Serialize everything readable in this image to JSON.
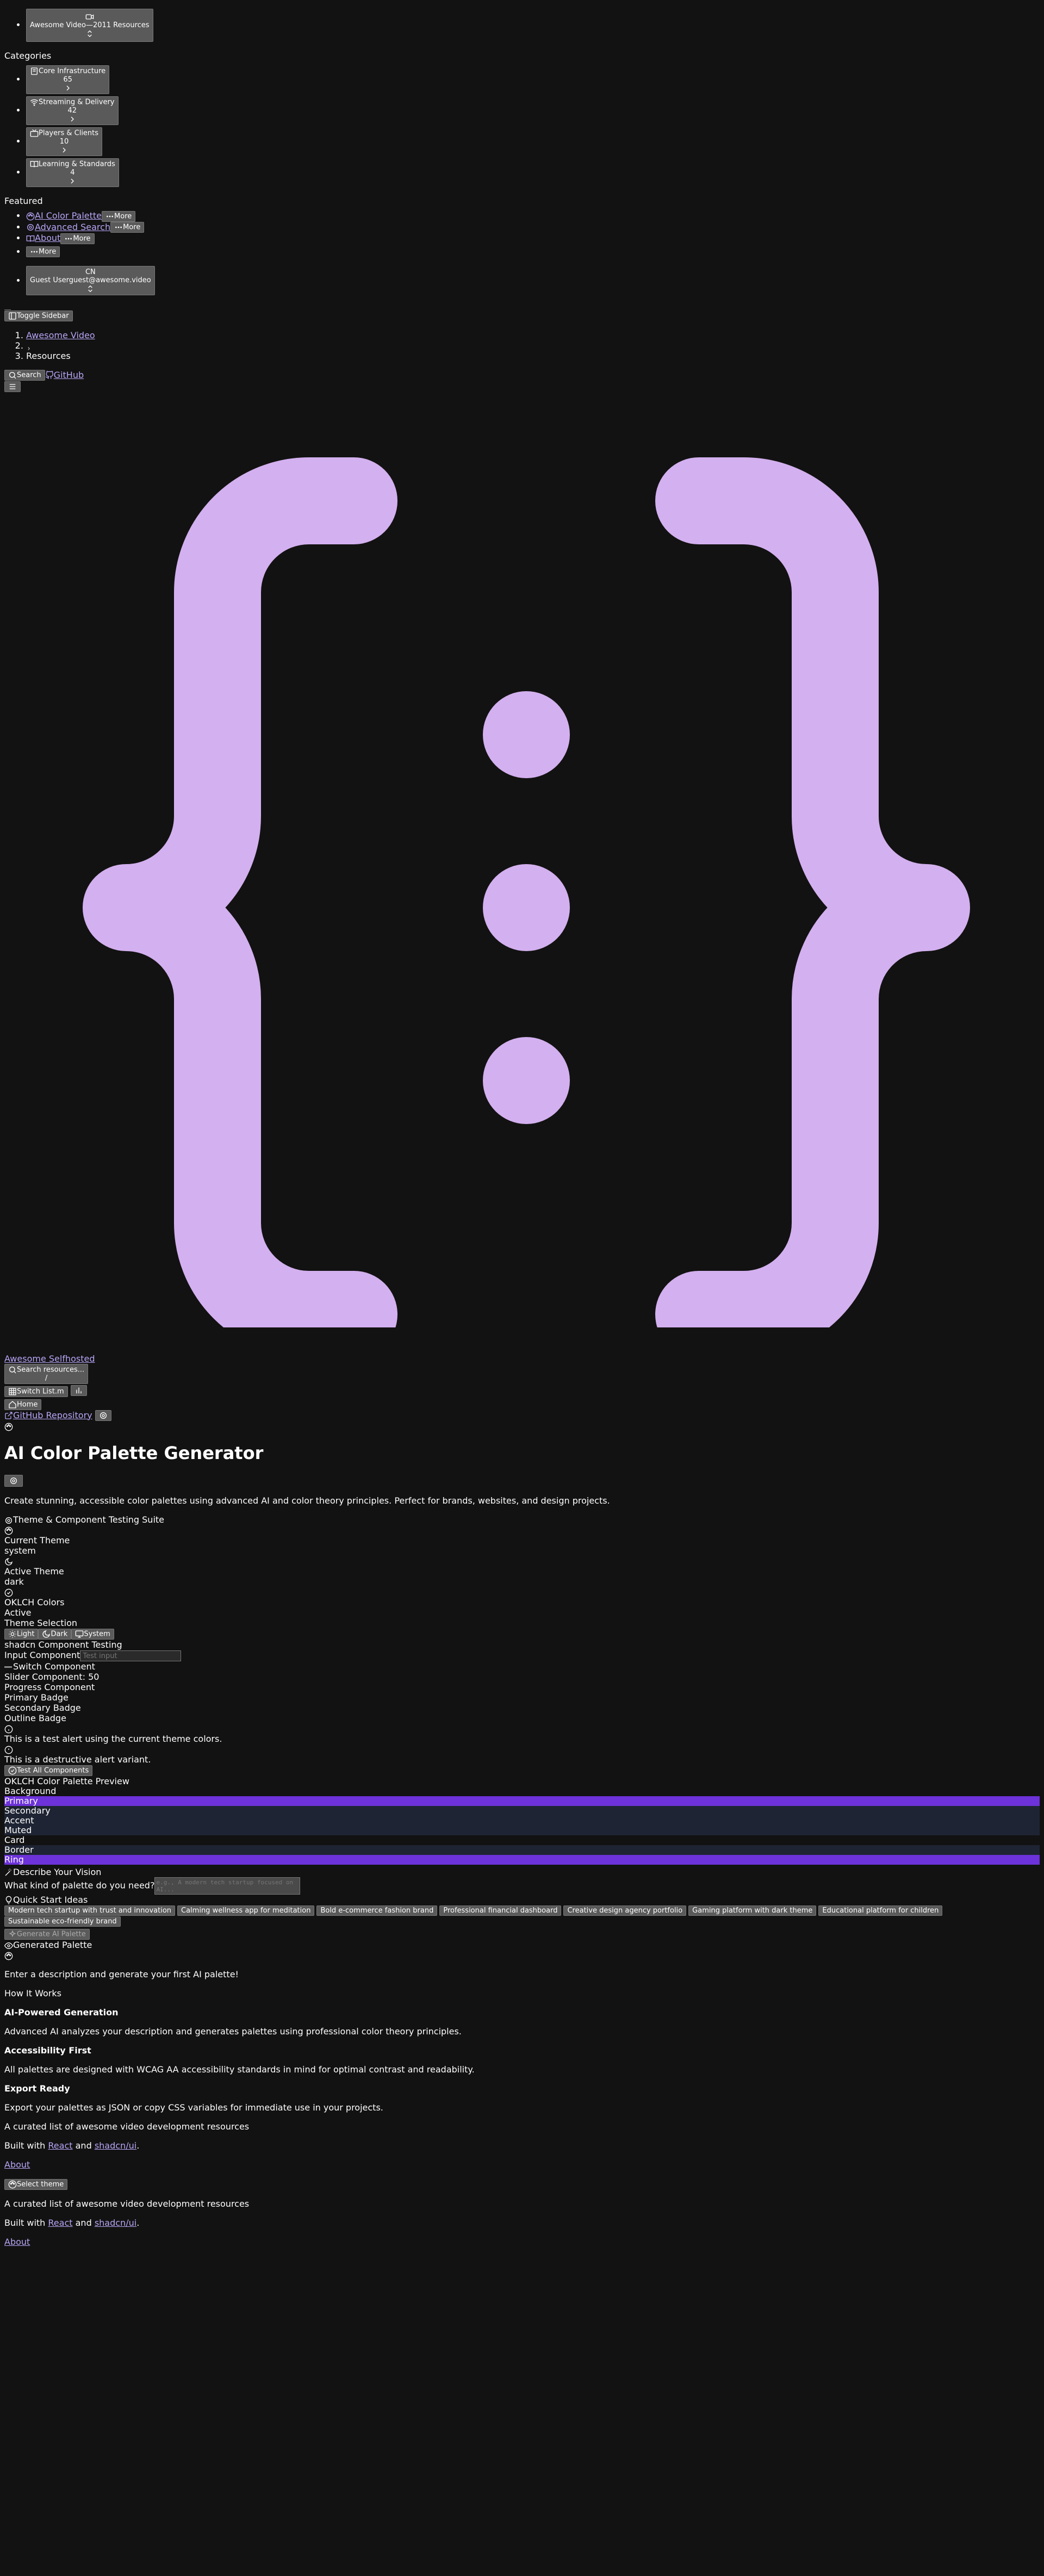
{
  "sidebar": {
    "team": {
      "name": "Awesome Video",
      "sep": "—",
      "count": "2011 Resources"
    },
    "categories_label": "Categories",
    "categories": [
      {
        "label": "Core Infrastructure",
        "count": "65"
      },
      {
        "label": "Streaming & Delivery",
        "count": "42"
      },
      {
        "label": "Players & Clients",
        "count": "10"
      },
      {
        "label": "Learning & Standards",
        "count": "4"
      }
    ],
    "featured_label": "Featured",
    "featured": [
      {
        "label": "AI Color Palette",
        "more": "More"
      },
      {
        "label": "Advanced Search",
        "more": "More"
      },
      {
        "label": "About",
        "more": "More"
      }
    ],
    "more_label": "More",
    "user": {
      "initials": "CN",
      "name": "Guest User",
      "email": "guest@awesome.video"
    },
    "toggle_label": "Toggle Sidebar"
  },
  "breadcrumb": {
    "home": "Awesome Video",
    "current": "Resources"
  },
  "topnav": {
    "search": "Search",
    "github": "GitHub"
  },
  "header2": {
    "site_link": "Awesome Selfhosted",
    "search_placeholder": "Search resources...",
    "search_kbd": "/",
    "switch_list": "Switch List.m",
    "home": "Home",
    "github_repo": "GitHub Repository"
  },
  "page": {
    "title": "AI Color Palette Generator",
    "description": "Create stunning, accessible color palettes using advanced AI and color theory principles. Perfect for brands, websites, and design projects."
  },
  "theme_suite": {
    "heading": "Theme & Component Testing Suite",
    "current_theme_label": "Current Theme",
    "current_theme_value": "system",
    "active_theme_label": "Active Theme",
    "active_theme_value": "dark",
    "oklch_label": "OKLCH Colors",
    "oklch_value": "Active",
    "selection_label": "Theme Selection",
    "buttons": {
      "light": "Light",
      "dark": "Dark",
      "system": "System"
    },
    "component_testing": "shadcn Component Testing",
    "input_label": "Input Component",
    "input_placeholder": "Test input",
    "switch_label": "Switch Component",
    "slider_label": "Slider Component: 50",
    "progress_label": "Progress Component",
    "badge_primary": "Primary Badge",
    "badge_secondary": "Secondary Badge",
    "badge_outline": "Outline Badge",
    "alert_text": "This is a test alert using the current theme colors.",
    "alert_destructive": "This is a destructive alert variant.",
    "test_all": "Test All Components"
  },
  "preview": {
    "heading": "OKLCH Color Palette Preview",
    "swatches": [
      {
        "label": "Background",
        "bg": "#121212",
        "fg": "#ffffff"
      },
      {
        "label": "Primary",
        "bg": "#6d32d9",
        "fg": "#ffffff"
      },
      {
        "label": "Secondary",
        "bg": "#1e2433",
        "fg": "#ffffff"
      },
      {
        "label": "Accent",
        "bg": "#1e2433",
        "fg": "#ffffff"
      },
      {
        "label": "Muted",
        "bg": "#1e2433",
        "fg": "#ffffff"
      },
      {
        "label": "Card",
        "bg": "#121212",
        "fg": "#ffffff"
      },
      {
        "label": "Border",
        "bg": "#1e2433",
        "fg": "#ffffff"
      },
      {
        "label": "Ring",
        "bg": "#6d32d9",
        "fg": "#ffffff"
      }
    ]
  },
  "describe": {
    "heading": "Describe Your Vision",
    "question": "What kind of palette do you need?",
    "placeholder": "e.g., A modern tech startup focused on AI...",
    "quick_start": "Quick Start Ideas",
    "ideas": [
      "Modern tech startup with trust and innovation",
      "Calming wellness app for meditation",
      "Bold e-commerce fashion brand",
      "Professional financial dashboard",
      "Creative design agency portfolio",
      "Gaming platform with dark theme",
      "Educational platform for children",
      "Sustainable eco-friendly brand"
    ],
    "generate": "Generate AI Palette"
  },
  "generated": {
    "heading": "Generated Palette",
    "empty": "Enter a description and generate your first AI palette!"
  },
  "how": {
    "heading": "How It Works",
    "items": [
      {
        "title": "AI-Powered Generation",
        "text": "Advanced AI analyzes your description and generates palettes using professional color theory principles."
      },
      {
        "title": "Accessibility First",
        "text": "All palettes are designed with WCAG AA accessibility standards in mind for optimal contrast and readability."
      },
      {
        "title": "Export Ready",
        "text": "Export your palettes as JSON or copy CSS variables for immediate use in your projects."
      }
    ]
  },
  "footer": {
    "tagline": "A curated list of awesome video development resources",
    "built_prefix": "Built with",
    "react": "React",
    "and": "and",
    "shadcn": "shadcn/ui",
    "period": ".",
    "about": "About",
    "select_theme": "Select theme"
  },
  "colors": {
    "brace": "#d3b0ef",
    "link": "#b9a6f6",
    "primary": "#6d32d9",
    "bg": "#121212"
  }
}
